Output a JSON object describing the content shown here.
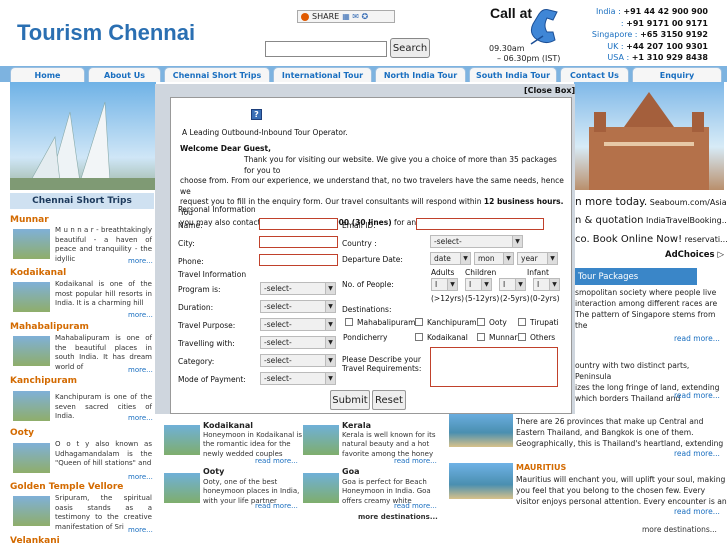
{
  "header": {
    "site_title": "Tourism Chennai",
    "share_label": "SHARE",
    "search_placeholder": "",
    "search_button": "Search",
    "call_label": "Call at",
    "hours_line1": "09.30am",
    "hours_line2": "– 06.30pm (IST)",
    "contacts": [
      {
        "country": "India :",
        "number": "+91 44 42 900 900"
      },
      {
        "country": ":",
        "number": "+91 9171 00 9171"
      },
      {
        "country": "Singapore :",
        "number": "+65 3150 9192"
      },
      {
        "country": "UK :",
        "number": "+44 207 100 9301"
      },
      {
        "country": "USA :",
        "number": "+1   310 929 8438"
      }
    ]
  },
  "nav": {
    "tabs": [
      "Home",
      "About Us",
      "Chennai Short Trips",
      "International Tour",
      "North India Tour",
      "South India Tour",
      "Contact Us",
      "Enquiry"
    ]
  },
  "sidebar": {
    "heading": "Chennai Short Trips",
    "items": [
      {
        "title": "Munnar",
        "text": "M u n n a r -   breathtakingly beautiful - a haven of peace and tranquility - the idyllic",
        "more": "more..."
      },
      {
        "title": "Kodaikanal",
        "text": "Kodaikanal is one of the most popular hill resorts in India. It is a charming hill",
        "more": "more..."
      },
      {
        "title": "Mahabalipuram",
        "text": "Mahabalipuram is one of the beautiful places in south India. It has dream world of",
        "more": "more..."
      },
      {
        "title": "Kanchipuram",
        "text": "Kanchipuram is one of the seven sacred cities of India.",
        "more": "more..."
      },
      {
        "title": "Ooty",
        "text": "O o t y also  known  as Udhagamandalam is the \"Queen of hill stations\" and",
        "more": "more..."
      },
      {
        "title": "Golden Temple Vellore",
        "text": "Sripuram, the spiritual oasis stands as a testimony to the creative manifestation of Sri",
        "more": "more..."
      },
      {
        "title": "Velankani",
        "text": "",
        "more": ""
      }
    ]
  },
  "popup": {
    "close_label": "[Close Box]",
    "help_icon": "?",
    "tagline": "A Leading Outbound-Inbound Tour Operator.",
    "greeting": "Welcome Dear Guest,",
    "intro_lines": [
      "Thank you for visiting our website. We give you a choice of more than 35 packages for you to",
      "choose from. From our experience, we understand that, no two travelers have the same needs, hence we",
      "request you to fill in the enquiry form. Our travel consultants will respond within",
      "you may also contact us at"
    ],
    "intro_bold1": "12 business hours.",
    "intro_after1": "  You",
    "intro_bold2": "044 42 900 900 (30 lines)",
    "intro_after2": " for any urgent requirement.",
    "personal_info": "Personal Information",
    "name_label": "Name:",
    "email_label": "Email ID:",
    "city_label": "City:",
    "country_label": "Country :",
    "country_select": "-select-",
    "phone_label": "Phone:",
    "departure_label": "Departure Date:",
    "date_select": "date",
    "month_select": "mon",
    "year_select": "year",
    "travel_info": "Travel Information",
    "people_label": "No. of People:",
    "adults_label": "Adults",
    "children_label": "Children",
    "infant_label": "Infant",
    "people_select": "I",
    "age_adults": "(>12yrs)",
    "age_children": "(5-12yrs)",
    "age_2to5": "(2-5yrs)",
    "age_infant": "(0-2yrs)",
    "program_label": "Program is:",
    "duration_label": "Duration:",
    "purpose_label": "Travel Purpose:",
    "travelling_label": "Travelling with:",
    "category_label": "Category:",
    "payment_label": "Mode of Payment:",
    "default_select": "-select-",
    "destinations_label": "Destinations:",
    "destinations": [
      "Mahabalipuram",
      "Kanchipuram",
      "Ooty",
      "Tirupati",
      "Pondicherry",
      "Kodaikanal",
      "Munnar",
      "Others"
    ],
    "requirements_label_line1": "Please Describe your",
    "requirements_label_line2": "Travel Requirements:",
    "submit_label": "Submit",
    "reset_label": "Reset"
  },
  "ads": {
    "line1_main": "n more today.",
    "line1_small": " Seaboum.com/Asia",
    "line2_main": "n & quotation",
    "line2_small": " IndiaTravelBooking...",
    "line3_main": "co. Book Online Now!",
    "line3_small": " reservati...",
    "adchoices": "AdChoices ▷"
  },
  "tour_packages": {
    "heading": "Tour Packages",
    "blocks": [
      {
        "lines": [
          "smopolitan society where people live",
          "interaction among different races are",
          "The pattern of Singapore stems from the"
        ],
        "more": "read more..."
      },
      {
        "lines": [
          "ountry with two distinct parts, Peninsula",
          "izes the long fringe of land, extending",
          "which borders Thailand and"
        ],
        "more": "read more..."
      },
      {
        "lines": [
          "There are 26 provinces that make up Central and",
          "Eastern Thailand, and Bangkok is one of them.",
          "Geographically, this is Thailand's heartland, extending"
        ],
        "more": "read more..."
      },
      {
        "title": "MAURITIUS",
        "lines": [
          "Mauritius will enchant you, will uplift your soul, making",
          "you feel that you belong to the chosen few. Every",
          "visitor enjoys personal attention. Every encounter is an"
        ],
        "more": "read more..."
      }
    ],
    "more_destinations": "more destinations..."
  },
  "mid": {
    "items": [
      {
        "title": "Kodaikanal",
        "text": [
          "Honeymoon in Kodaikanal is",
          "the romantic idea for the",
          "newly wedded couples"
        ],
        "more": "read more..."
      },
      {
        "title": "Kerala",
        "text": [
          "Kerala is well known for its",
          "natural beauty and a hot",
          "favorite among the honey"
        ],
        "more": "read more..."
      },
      {
        "title": "Ooty",
        "text": [
          "Ooty, one of the best",
          "honeymoon places in India,",
          "with your life partner"
        ],
        "more": "read more..."
      },
      {
        "title": "Goa",
        "text": [
          "Goa is perfect for Beach",
          "Honeymoon in India. Goa",
          "offers creamy white"
        ],
        "more": "read more..."
      }
    ],
    "more_destinations": "more destinations..."
  }
}
